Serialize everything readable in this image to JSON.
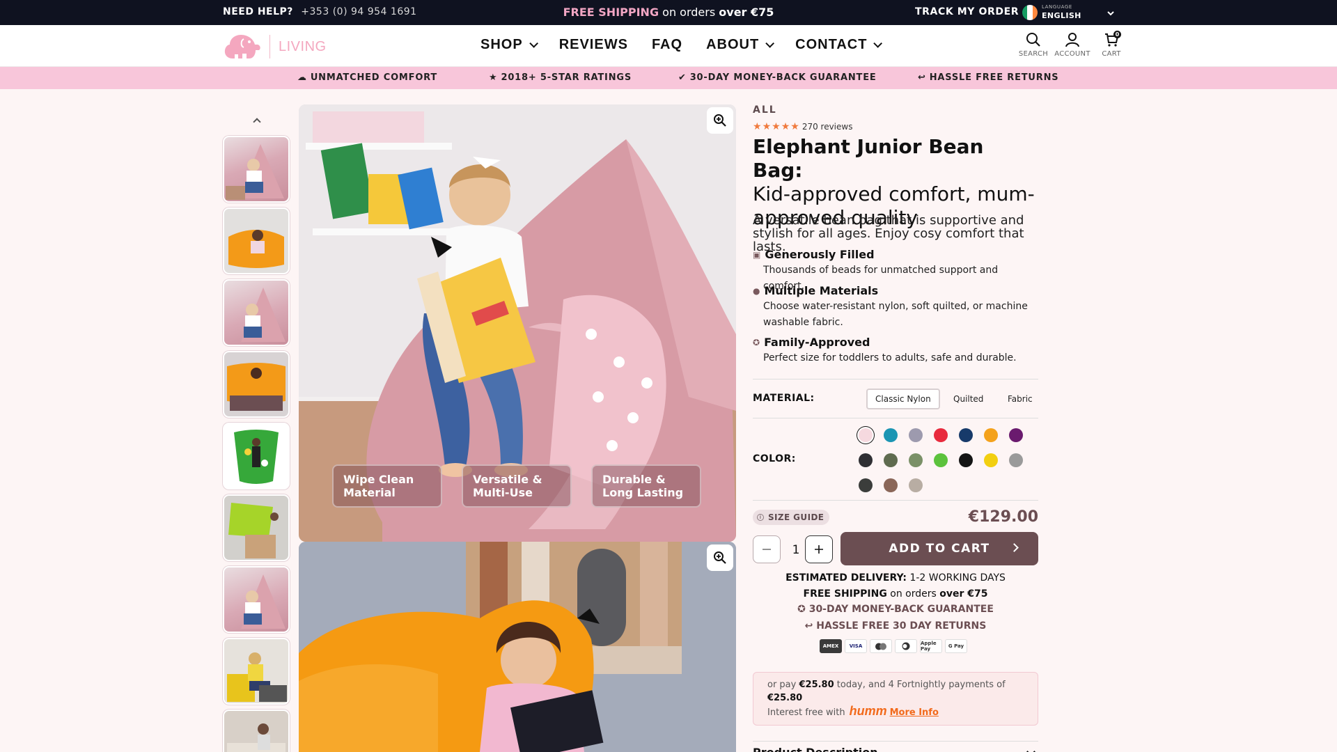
{
  "topbar": {
    "help_label": "NEED HELP?",
    "phone": "+353 (0) 94 954 1691",
    "shipping_highlight": "FREE SHIPPING",
    "shipping_mid": " on orders ",
    "shipping_over": "over",
    "shipping_amount": " €75",
    "track_label": "TRACK MY ORDER",
    "language_caption": "LANGUAGE",
    "language_value": "ENGLISH"
  },
  "header": {
    "logo_text": "LIVING",
    "nav": [
      {
        "label": "SHOP",
        "has_caret": true
      },
      {
        "label": "REVIEWS",
        "has_caret": false
      },
      {
        "label": "FAQ",
        "has_caret": false
      },
      {
        "label": "ABOUT",
        "has_caret": true
      },
      {
        "label": "CONTACT",
        "has_caret": true
      }
    ],
    "icons": {
      "search": "SEARCH",
      "account": "ACCOUNT",
      "cart": "CART",
      "cart_count": "0"
    }
  },
  "benefits": [
    {
      "icon": "cloud-icon",
      "label": "UNMATCHED COMFORT"
    },
    {
      "icon": "star-icon",
      "label": "2018+ 5-STAR RATINGS"
    },
    {
      "icon": "check-badge-icon",
      "label": "30-DAY MONEY-BACK GUARANTEE"
    },
    {
      "icon": "return-icon",
      "label": "HASSLE FREE RETURNS"
    }
  ],
  "gallery": {
    "tags": [
      "Wipe Clean Material",
      "Versatile & Multi-Use",
      "Durable & Long Lasting"
    ],
    "tag_lines": [
      [
        "Wipe Clean",
        "Material"
      ],
      [
        "Versatile &",
        "Multi-Use"
      ],
      [
        "Durable &",
        "Long Lasting"
      ]
    ]
  },
  "product": {
    "breadcrumb": "ALL",
    "rating": 5,
    "reviews": "270 reviews",
    "title_bold": "Elephant Junior Bean Bag:",
    "title_rest": "Kid-approved comfort, mum-approved quality",
    "description": "A versatile bean bag that is supportive and stylish for all ages. Enjoy cosy comfort that lasts.",
    "features": [
      {
        "icon": "box-icon",
        "title": "Generously Filled",
        "body": "Thousands of beads for unmatched support and comfort."
      },
      {
        "icon": "fabric-icon",
        "title": "Multiple Materials",
        "body": "Choose water-resistant nylon, soft quilted, or machine washable fabric."
      },
      {
        "icon": "award-icon",
        "title": "Family-Approved",
        "body": "Perfect size for toddlers to adults, safe and durable."
      }
    ],
    "material_label": "MATERIAL:",
    "materials": [
      "Classic Nylon",
      "Quilted",
      "Fabric"
    ],
    "selected_material": "Classic Nylon",
    "color_label": "COLOR:",
    "colors": [
      "#f6d9df",
      "#1b95b3",
      "#9d9aae",
      "#e82a3d",
      "#173a6a",
      "#f4a21c",
      "#6a1a6e",
      "#2f2f33",
      "#5f6b4f",
      "#7a9067",
      "#5cc23c",
      "#141414",
      "#f2cf10",
      "#9a9a9a",
      "#3b3d3b",
      "#8a6658",
      "#b8ada3"
    ],
    "selected_color": "#f6d9df",
    "size_guide": "SIZE GUIDE",
    "price": "€129.00",
    "quantity": "1",
    "add_to_cart": "ADD TO CART"
  },
  "assurance": {
    "delivery_label": "ESTIMATED DELIVERY:",
    "delivery_value": " 1-2 WORKING DAYS",
    "ship_bold": "FREE SHIPPING",
    "ship_mid": " on orders ",
    "ship_over": "over €75",
    "guarantee": "30-DAY MONEY-BACK GUARANTEE",
    "returns": "HASSLE FREE 30 DAY RETURNS",
    "payments": [
      "AMEX",
      "VISA",
      "mastercard",
      "diners",
      "Apple Pay",
      "G Pay"
    ]
  },
  "humm": {
    "prefix": "or pay ",
    "amount": "€25.80",
    "mid": " today, and 4 Fortnightly payments of",
    "amount2": "€25.80",
    "interest": "Interest free with",
    "brand": "humm",
    "more": "More Info"
  },
  "accordion": {
    "product_description": "Product Description"
  }
}
